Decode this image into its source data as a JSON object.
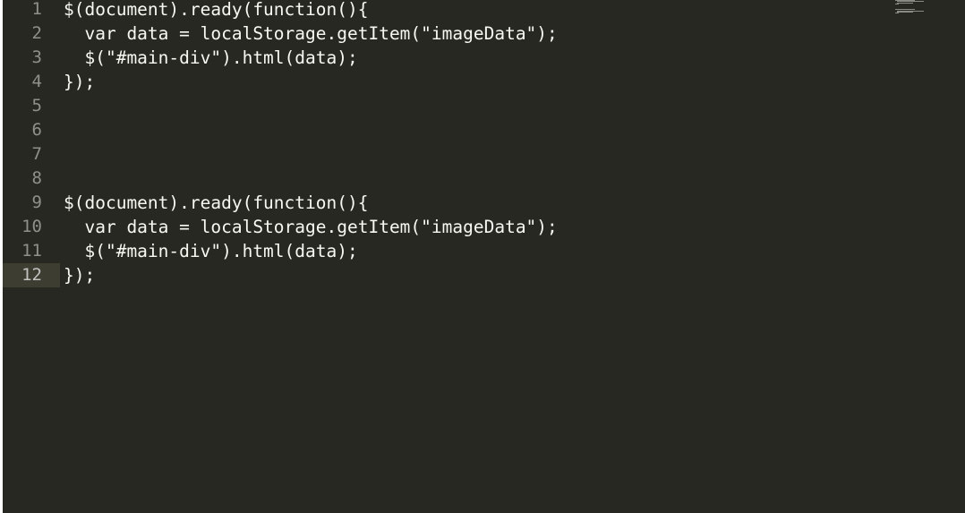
{
  "editor": {
    "active_line": 12,
    "lines": [
      {
        "num": "1",
        "text": "$(document).ready(function(){"
      },
      {
        "num": "2",
        "text": "  var data = localStorage.getItem(\"imageData\");"
      },
      {
        "num": "3",
        "text": "  $(\"#main-div\").html(data);"
      },
      {
        "num": "4",
        "text": "});"
      },
      {
        "num": "5",
        "text": ""
      },
      {
        "num": "6",
        "text": ""
      },
      {
        "num": "7",
        "text": ""
      },
      {
        "num": "8",
        "text": ""
      },
      {
        "num": "9",
        "text": "$(document).ready(function(){"
      },
      {
        "num": "10",
        "text": "  var data = localStorage.getItem(\"imageData\");"
      },
      {
        "num": "11",
        "text": "  $(\"#main-div\").html(data);"
      },
      {
        "num": "12",
        "text": "});"
      }
    ]
  },
  "colors": {
    "background": "#272822",
    "active_line": "#3e3d32",
    "text": "#f8f8f2",
    "gutter_text": "#90908a"
  }
}
